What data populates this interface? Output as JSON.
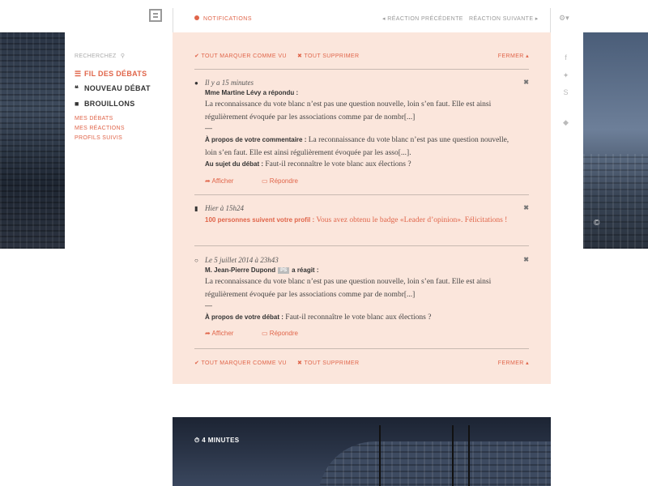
{
  "topbar": {
    "notifications_label": "NOTIFICATIONS",
    "prev_label": "RÉACTION PRÉCÉDENTE",
    "next_label": "RÉACTION SUIVANTE",
    "logo_icon": "logo-icon",
    "settings_icon": "gear-icon"
  },
  "sidebar": {
    "search_label": "RECHERCHEZ",
    "nav": [
      {
        "label": "FIL DES DÉBATS",
        "icon": "list-icon",
        "active": true
      },
      {
        "label": "NOUVEAU DÉBAT",
        "icon": "quote-icon",
        "active": false
      },
      {
        "label": "BROUILLONS",
        "icon": "book-icon",
        "active": false
      }
    ],
    "sub": [
      "MES DÉBATS",
      "MES RÉACTIONS",
      "PROFILS SUIVIS"
    ]
  },
  "social": {
    "icons": [
      "facebook-icon",
      "twitter-icon",
      "skype-icon",
      "diamond-icon"
    ]
  },
  "panel": {
    "mark_all": "TOUT MARQUER COMME VU",
    "delete_all": "TOUT SUPPRIMER",
    "close": "FERMER",
    "items": [
      {
        "time": "Il y a 15 minutes",
        "author": "Mme Martine Lévy a répondu :",
        "text": "La reconnaissance du vote blanc n’est pas une question nouvelle, loin s’en faut. Elle est ainsi régulièrement évoquée par les associations comme par de nombr[...]",
        "dash": "—",
        "about_label": "À propos de votre commentaire :",
        "about_text": "La reconnaissance du vote blanc n’est pas une question nouvelle, loin s’en faut. Elle est ainsi régulièrement évoquée par les asso[...].",
        "debate_label": "Au sujet du débat :",
        "debate_text": "Faut-il reconnaître le vote blanc aux élections ?",
        "action_show": "Afficher",
        "action_reply": "Répondre"
      },
      {
        "time": "Hier à 15h24",
        "title": "100 personnes suivent votre profil :",
        "text": "Vous avez obtenu le badge «Leader d’opinion». Félicitations !"
      },
      {
        "time": "Le 5 juillet 2014 à 23h43",
        "author": "M. Jean-Pierre Dupond",
        "badge": "PS",
        "author_suffix": "a réagit :",
        "text": "La reconnaissance du vote blanc n’est pas une question nouvelle, loin s’en faut. Elle est ainsi régulièrement évoquée par les associations comme par de nombr[...]",
        "dash": "—",
        "about_label": "À propos de votre débat :",
        "about_text": "Faut-il reconnaître le vote blanc aux élections ?",
        "action_show": "Afficher",
        "action_reply": "Répondre"
      }
    ]
  },
  "card": {
    "duration": "4 MINUTES",
    "timer_icon": "stopwatch-icon"
  },
  "photo": {
    "copyright": "©"
  },
  "colors": {
    "accent": "#e0654a",
    "panel_bg": "#fbe6dc"
  }
}
